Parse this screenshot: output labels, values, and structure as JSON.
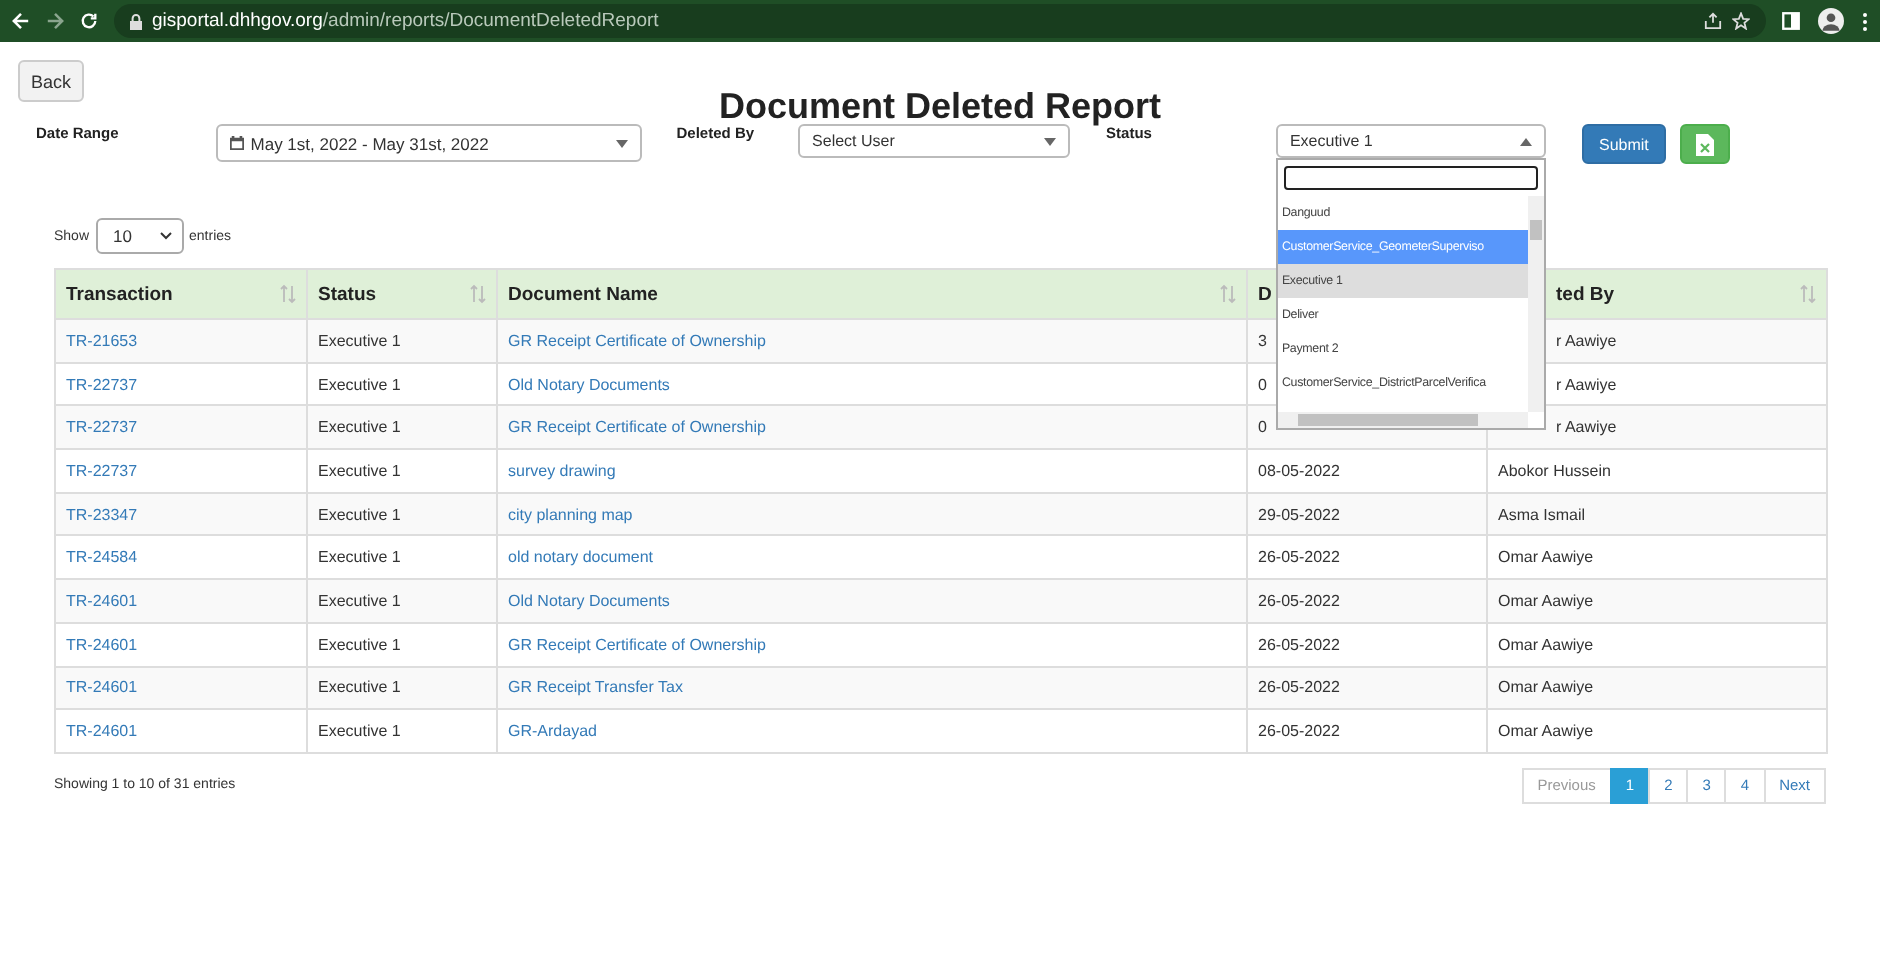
{
  "browser": {
    "url": "**gisportal.dhhgov.org**/admin/reports/DocumentDeletedReport"
  },
  "back_button": "Back",
  "title": "Document Deleted Report",
  "filters": {
    "date_range": {
      "label": "Date Range",
      "value": "May 1st, 2022 - May 31st, 2022"
    },
    "deleted_by": {
      "label": "Deleted By",
      "value": "Select User"
    },
    "status": {
      "label": "Status",
      "value": "Executive 1",
      "expanded": true,
      "options": [
        {
          "label": "Danguud",
          "selected": false,
          "highlighted": false
        },
        {
          "label": "CustomerService_GeometerSuperviso",
          "selected": false,
          "highlighted": true
        },
        {
          "label": "Executive 1",
          "selected": true,
          "highlighted": false
        },
        {
          "label": "Deliver",
          "selected": false,
          "highlighted": false
        },
        {
          "label": "Payment 2",
          "selected": false,
          "highlighted": false
        },
        {
          "label": "CustomerService_DistrictParcelVerifica",
          "selected": false,
          "highlighted": false
        }
      ]
    },
    "submit": "Submit"
  },
  "length": {
    "prefix": "Show",
    "value": "10",
    "suffix": "entries"
  },
  "table": {
    "columns": [
      {
        "label": "Transaction",
        "sortable": true,
        "covered": false
      },
      {
        "label": "Status",
        "sortable": true,
        "covered": false
      },
      {
        "label": "Document Name",
        "sortable": true,
        "covered": false
      },
      {
        "label": "D",
        "sortable": false,
        "covered": false
      },
      {
        "label": "ted By",
        "sortable": true,
        "covered": true
      }
    ],
    "rows": [
      {
        "transaction": "TR-21653",
        "status": "Executive 1",
        "document": "GR Receipt Certificate of Ownership",
        "date": "3",
        "deleted_by": "r Aawiye",
        "covered": true
      },
      {
        "transaction": "TR-22737",
        "status": "Executive 1",
        "document": "Old Notary Documents",
        "date": "0",
        "deleted_by": "r Aawiye",
        "covered": true
      },
      {
        "transaction": "TR-22737",
        "status": "Executive 1",
        "document": "GR Receipt Certificate of Ownership",
        "date": "0",
        "deleted_by": "r Aawiye",
        "covered": true
      },
      {
        "transaction": "TR-22737",
        "status": "Executive 1",
        "document": "survey drawing",
        "date": "08-05-2022",
        "deleted_by": "Abokor Hussein",
        "covered": false
      },
      {
        "transaction": "TR-23347",
        "status": "Executive 1",
        "document": "city planning map",
        "date": "29-05-2022",
        "deleted_by": "Asma Ismail",
        "covered": false
      },
      {
        "transaction": "TR-24584",
        "status": "Executive 1",
        "document": "old notary document",
        "date": "26-05-2022",
        "deleted_by": "Omar Aawiye",
        "covered": false
      },
      {
        "transaction": "TR-24601",
        "status": "Executive 1",
        "document": "Old Notary Documents",
        "date": "26-05-2022",
        "deleted_by": "Omar Aawiye",
        "covered": false
      },
      {
        "transaction": "TR-24601",
        "status": "Executive 1",
        "document": "GR Receipt Certificate of Ownership",
        "date": "26-05-2022",
        "deleted_by": "Omar Aawiye",
        "covered": false
      },
      {
        "transaction": "TR-24601",
        "status": "Executive 1",
        "document": "GR Receipt Transfer Tax",
        "date": "26-05-2022",
        "deleted_by": "Omar Aawiye",
        "covered": false
      },
      {
        "transaction": "TR-24601",
        "status": "Executive 1",
        "document": "GR-Ardayad",
        "date": "26-05-2022",
        "deleted_by": "Omar Aawiye",
        "covered": false
      }
    ]
  },
  "info": "Showing 1 to 10 of 31 entries",
  "pagination": [
    {
      "label": "Previous",
      "selected": false,
      "disabled": true
    },
    {
      "label": "1",
      "selected": true,
      "disabled": false
    },
    {
      "label": "2",
      "selected": false,
      "disabled": false
    },
    {
      "label": "3",
      "selected": false,
      "disabled": false
    },
    {
      "label": "4",
      "selected": false,
      "disabled": false
    },
    {
      "label": "Next",
      "selected": false,
      "disabled": false
    }
  ]
}
